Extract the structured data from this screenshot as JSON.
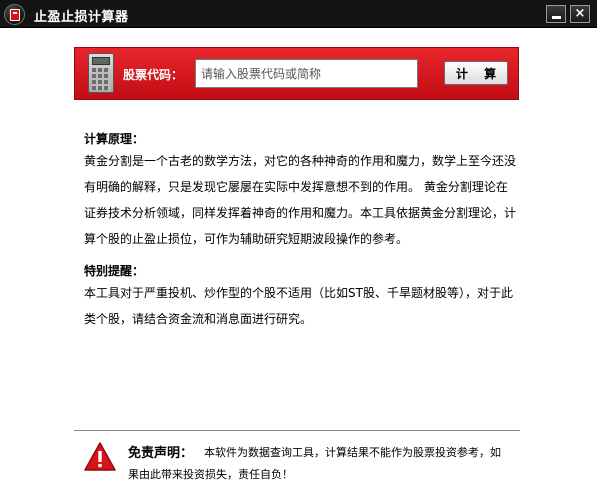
{
  "window": {
    "title": "止盈止损计算器",
    "minimize_label": "",
    "close_label": "×"
  },
  "banner": {
    "code_label": "股票代码：",
    "search_placeholder": "请输入股票代码或简称",
    "calc_button_label": "计 算",
    "accent_color": "#d8141b"
  },
  "principle": {
    "heading": "计算原理：",
    "text": "黄金分割是一个古老的数学方法，对它的各种神奇的作用和魔力，数学上至今还没有明确的解释，只是发现它屡屡在实际中发挥意想不到的作用。 黄金分割理论在证券技术分析领域，同样发挥着神奇的作用和魔力。本工具依据黄金分割理论，计算个股的止盈止损位，可作为辅助研究短期波段操作的参考。"
  },
  "notice": {
    "heading": "特别提醒：",
    "text": "本工具对于严重投机、炒作型的个股不适用（比如ST股、千旱题材股等），对于此类个股，请结合资金流和消息面进行研究。"
  },
  "disclaimer": {
    "title": "免责声明：",
    "text": "本软件为数据查询工具，计算结果不能作为股票投资参考，如果由此带来投资损失，责任自负！",
    "icon": "warning-triangle-icon"
  }
}
